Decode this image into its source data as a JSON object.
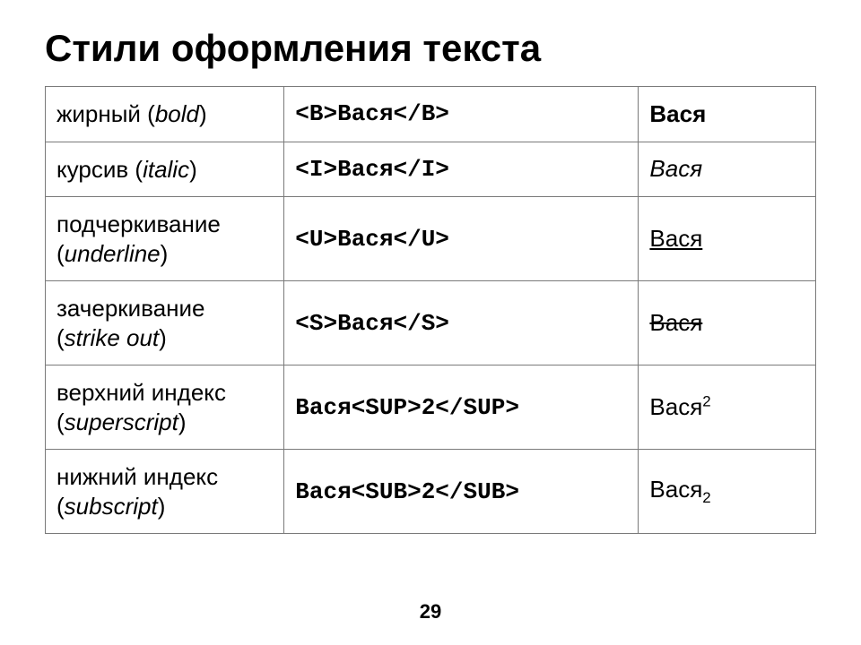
{
  "title": "Стили оформления текста",
  "page_number": "29",
  "rows": [
    {
      "name_ru": "жирный",
      "name_en": "bold",
      "code": "<B>Вася</B>",
      "result_class": "b",
      "result_base": "Вася",
      "result_suffix": ""
    },
    {
      "name_ru": "курсив",
      "name_en": "italic",
      "code": "<I>Вася</I>",
      "result_class": "i",
      "result_base": "Вася",
      "result_suffix": ""
    },
    {
      "name_ru": "подчеркивание",
      "name_en": "underline",
      "code": "<U>Вася</U>",
      "result_class": "u",
      "result_base": "Вася",
      "result_suffix": ""
    },
    {
      "name_ru": "зачеркивание",
      "name_en": "strike out",
      "code": "<S>Вася</S>",
      "result_class": "s",
      "result_base": "Вася",
      "result_suffix": ""
    },
    {
      "name_ru": "верхний индекс",
      "name_en": "superscript",
      "code": "Вася<SUP>2</SUP>",
      "result_class": "sup",
      "result_base": "Вася",
      "result_suffix": "2"
    },
    {
      "name_ru": "нижний индекс",
      "name_en": "subscript",
      "code": "Вася<SUB>2</SUB>",
      "result_class": "sub",
      "result_base": "Вася",
      "result_suffix": "2"
    }
  ]
}
